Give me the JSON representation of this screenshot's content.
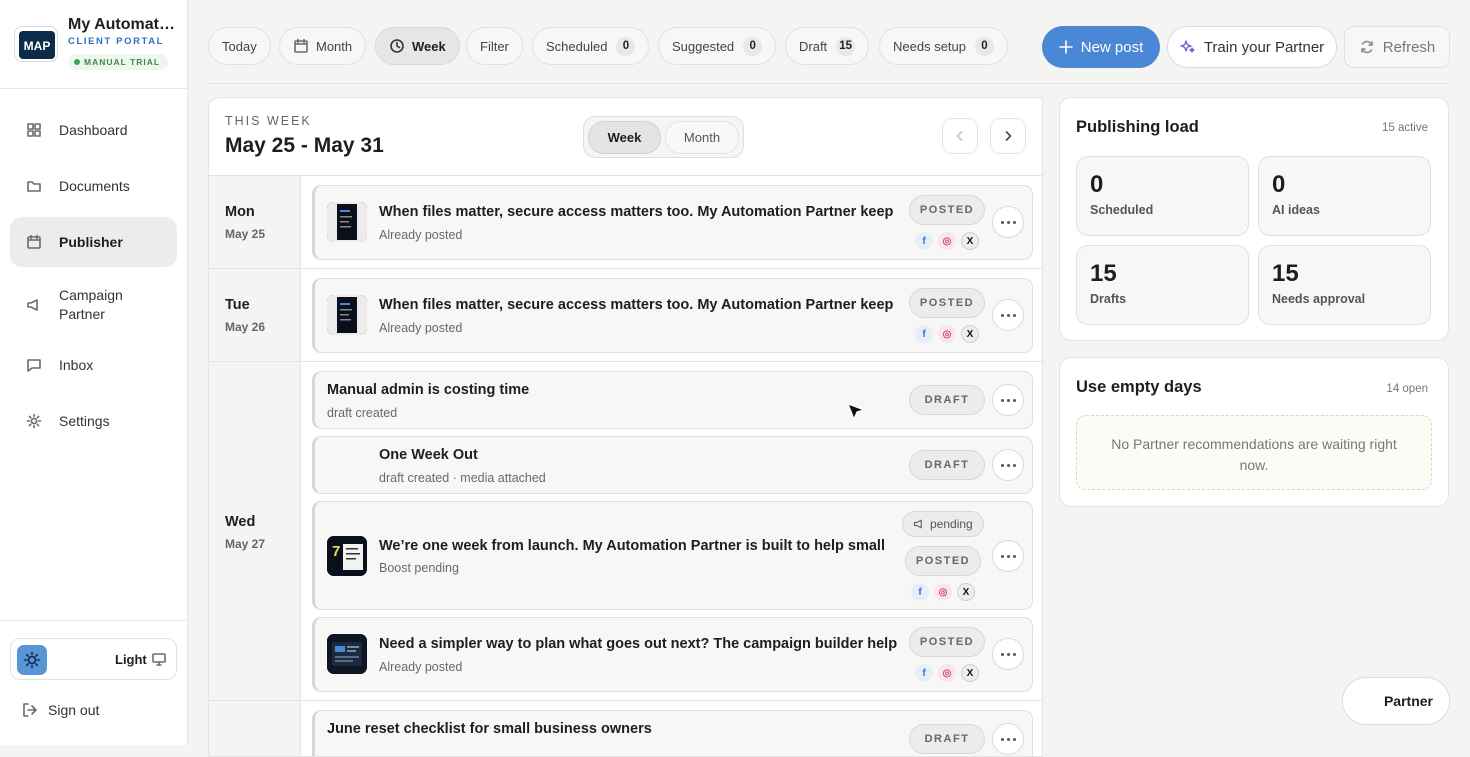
{
  "brand": {
    "title": "My Automati…",
    "subtitle": "CLIENT PORTAL",
    "badge": "MANUAL TRIAL",
    "logo_text": "MAP"
  },
  "sidebar": {
    "items": [
      {
        "label": "Dashboard",
        "icon": "grid-icon"
      },
      {
        "label": "Documents",
        "icon": "folder-icon"
      },
      {
        "label": "Publisher",
        "icon": "calendar-icon",
        "active": true
      },
      {
        "label": "Campaign Partner",
        "icon": "megaphone-icon"
      },
      {
        "label": "Inbox",
        "icon": "chat-icon"
      },
      {
        "label": "Settings",
        "icon": "gear-icon"
      }
    ],
    "theme_label": "Light",
    "signout": "Sign out"
  },
  "toolbar": {
    "today": "Today",
    "month": "Month",
    "week": "Week",
    "filter": "Filter",
    "scheduled": {
      "label": "Scheduled",
      "count": "0"
    },
    "suggested": {
      "label": "Suggested",
      "count": "0"
    },
    "draft": {
      "label": "Draft",
      "count": "15"
    },
    "needs_setup": {
      "label": "Needs setup",
      "count": "0"
    },
    "new_post": "New post",
    "train": "Train your Partner",
    "refresh": "Refresh"
  },
  "calendar": {
    "eyebrow": "THIS WEEK",
    "range": "May 25 - May 31",
    "toggle": {
      "week": "Week",
      "month": "Month"
    },
    "days": [
      {
        "name": "Mon",
        "date": "May 25"
      },
      {
        "name": "Tue",
        "date": "May 26"
      },
      {
        "name": "Wed",
        "date": "May 27"
      }
    ],
    "posts": [
      {
        "title": "When files matter, secure access matters too. My Automation Partner keep",
        "sub": "Already posted",
        "status": "POSTED"
      },
      {
        "title": "When files matter, secure access matters too. My Automation Partner keep",
        "sub": "Already posted",
        "status": "POSTED"
      },
      {
        "title": "Manual admin is costing time",
        "sub": "draft created",
        "status": "DRAFT"
      },
      {
        "title": "One Week Out",
        "sub": "draft created · media attached",
        "status": "DRAFT"
      },
      {
        "title": "We’re one week from launch. My Automation Partner is built to help small",
        "sub": "Boost pending",
        "status": "POSTED",
        "tag": "pending"
      },
      {
        "title": "Need a simpler way to plan what goes out next? The campaign builder help",
        "sub": "Already posted",
        "status": "POSTED"
      },
      {
        "title": "June reset checklist for small business owners",
        "sub": "",
        "status": "DRAFT"
      }
    ]
  },
  "load": {
    "title": "Publishing load",
    "meta": "15 active",
    "stats": [
      {
        "value": "0",
        "label": "Scheduled"
      },
      {
        "value": "0",
        "label": "AI ideas"
      },
      {
        "value": "15",
        "label": "Drafts"
      },
      {
        "value": "15",
        "label": "Needs approval"
      }
    ]
  },
  "empty_days": {
    "title": "Use empty days",
    "meta": "14 open",
    "message": "No Partner recommendations are waiting right now."
  },
  "partner_button": "Partner",
  "colors": {
    "accent": "#4a87d7",
    "facebook": "#3b6fce",
    "instagram": "#d0457f"
  }
}
